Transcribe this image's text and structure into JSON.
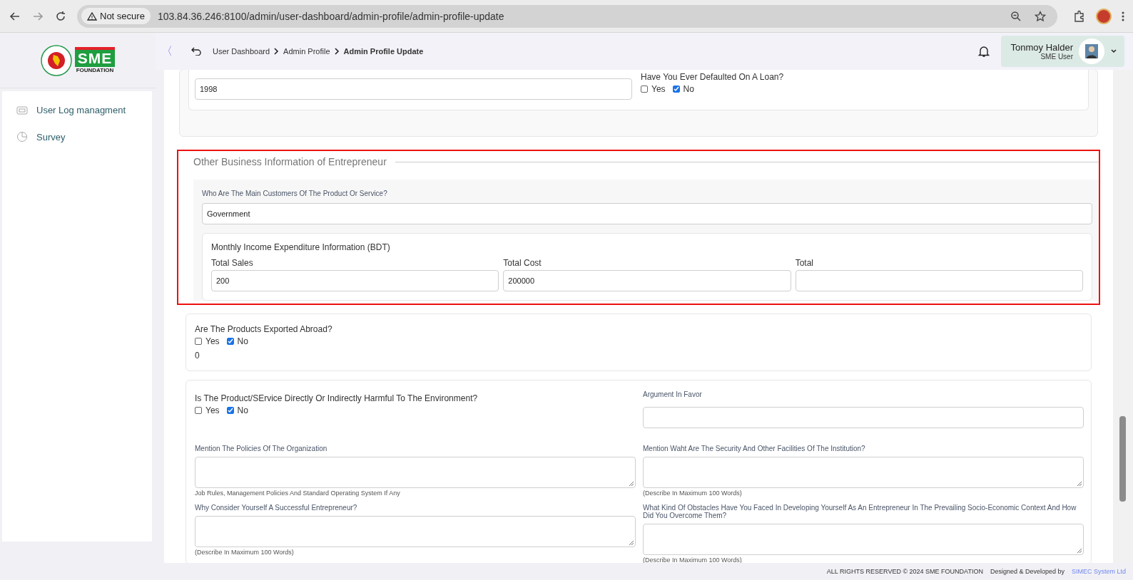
{
  "browser": {
    "security": "Not secure",
    "url": "103.84.36.246:8100/admin/user-dashboard/admin-profile/admin-profile-update"
  },
  "logo": {
    "mark": "SME",
    "subtext": "FOUNDATION"
  },
  "sidebar": {
    "items": [
      {
        "label": "User Log managment",
        "kind": "log"
      },
      {
        "label": "Survey",
        "kind": "survey"
      }
    ]
  },
  "header": {
    "collapse": "〈",
    "breadcrumb": [
      "User Dashboard",
      "Admin Profile",
      "Admin Profile Update"
    ],
    "user": {
      "name": "Tonmoy Halder",
      "role": "SME User"
    }
  },
  "top_card": {
    "value": "1998",
    "question": "Have You Ever Defaulted On A Loan?",
    "options": [
      {
        "label": "Yes",
        "checked": false
      },
      {
        "label": "No",
        "checked": true
      }
    ]
  },
  "section": {
    "title": "Other Business Information of Entrepreneur",
    "highlighted": true,
    "customers_label": "Who Are The Main Customers Of The Product Or Service?",
    "customers_value": "Government",
    "income": {
      "title": "Monthly Income Expenditure Information (BDT)",
      "fields": [
        {
          "label": "Total Sales",
          "value": "200"
        },
        {
          "label": "Total Cost",
          "value": "200000"
        },
        {
          "label": "Total"
        }
      ]
    }
  },
  "export_card": {
    "question": "Are The Products Exported Abroad?",
    "options": [
      {
        "label": "Yes",
        "checked": false
      },
      {
        "label": "No",
        "checked": true
      }
    ],
    "value": "0"
  },
  "details": [
    {
      "kind": "checks",
      "label": "Is The Product/SErvice Directly Or Indirectly Harmful To The Environment?",
      "options": [
        {
          "label": "Yes",
          "checked": false
        },
        {
          "label": "No",
          "checked": true
        }
      ]
    },
    {
      "kind": "input",
      "label": "Argument In Favor"
    },
    {
      "kind": "textarea",
      "label": "Mention The Policies Of The Organization",
      "hint": "Job Rules, Management Policies And Standard Operating System If Any"
    },
    {
      "kind": "textarea",
      "label": "Mention Waht Are The Security And Other Facilities Of The Institution?",
      "hint": "(Describe In Maximum 100 Words)"
    },
    {
      "kind": "textarea",
      "label": "Why Consider Yourself A Successful Entrepreneur?",
      "hint": "(Describe In Maximum 100 Words)"
    },
    {
      "kind": "textarea",
      "label": "What Kind Of Obstacles Have You Faced In Developing Yourself As An Entrepreneur In The Prevailing Socio-Economic Context And How Did You Overcome Them?",
      "hint": "(Describe In Maximum 100 Words)"
    }
  ],
  "footer": {
    "rights": "ALL RIGHTS RESERVED © 2024 SME FOUNDATION",
    "designed": "Designed & Developed by",
    "company": "SIMEC System Ltd"
  }
}
